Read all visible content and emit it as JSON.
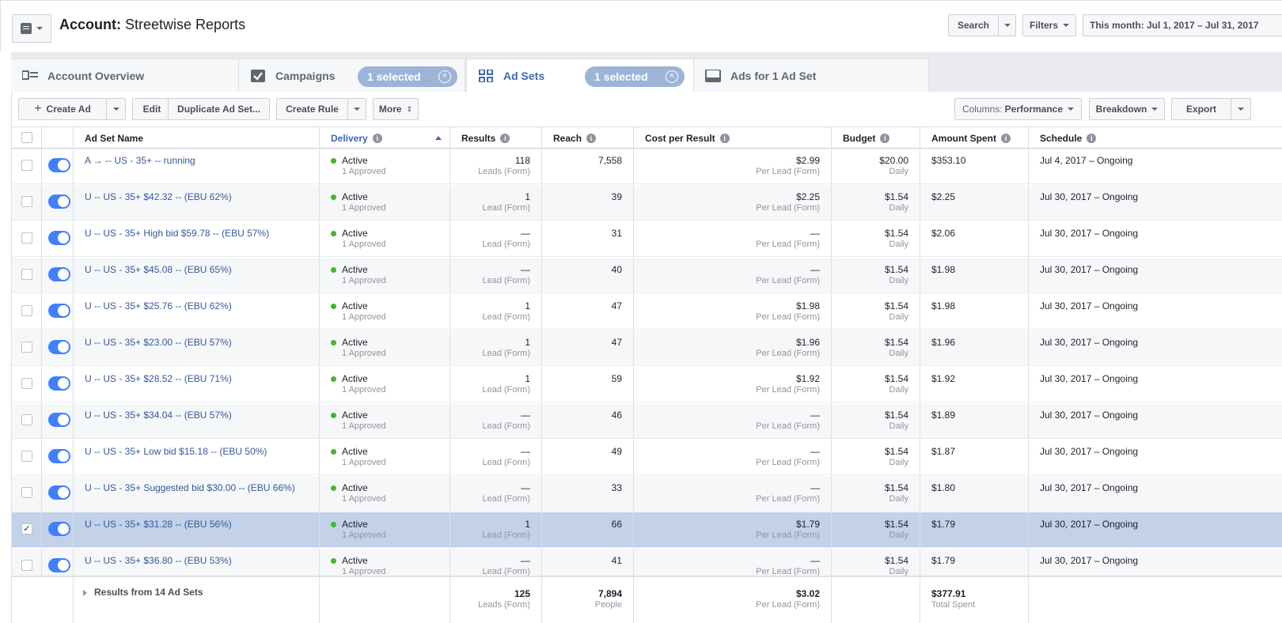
{
  "header": {
    "account_label": "Account:",
    "account_name": "Streetwise Reports",
    "search_label": "Search",
    "filters_label": "Filters",
    "date_range": "This month: Jul 1, 2017 – Jul 31, 2017"
  },
  "tabs": [
    {
      "label": "Account Overview"
    },
    {
      "label": "Campaigns",
      "selected_badge": "1 selected"
    },
    {
      "label": "Ad Sets",
      "selected_badge": "1 selected"
    },
    {
      "label": "Ads for 1 Ad Set"
    }
  ],
  "toolbar": {
    "create_ad": "Create Ad",
    "edit": "Edit",
    "duplicate": "Duplicate Ad Set...",
    "create_rule": "Create Rule",
    "more": "More",
    "columns_prefix": "Columns:",
    "columns_value": "Performance",
    "breakdown": "Breakdown",
    "export": "Export"
  },
  "columns": {
    "name": "Ad Set Name",
    "delivery": "Delivery",
    "results": "Results",
    "reach": "Reach",
    "cost": "Cost per Result",
    "budget": "Budget",
    "spent": "Amount Spent",
    "schedule": "Schedule"
  },
  "rows": [
    {
      "name": "A → -- US - 35+ -- running",
      "delivery": "Active",
      "delivery_sub": "1 Approved",
      "results": "118",
      "results_sub": "Leads (Form)",
      "reach": "7,558",
      "cost": "$2.99",
      "cost_sub": "Per Lead (Form)",
      "budget": "$20.00",
      "budget_sub": "Daily",
      "spent": "$353.10",
      "schedule": "Jul 4, 2017 – Ongoing",
      "checked": false
    },
    {
      "name": "U -- US - 35+ $42.32 -- (EBU 62%)",
      "delivery": "Active",
      "delivery_sub": "1 Approved",
      "results": "1",
      "results_sub": "Lead (Form)",
      "reach": "39",
      "cost": "$2.25",
      "cost_sub": "Per Lead (Form)",
      "budget": "$1.54",
      "budget_sub": "Daily",
      "spent": "$2.25",
      "schedule": "Jul 30, 2017 – Ongoing",
      "checked": false
    },
    {
      "name": "U -- US - 35+ High bid $59.78 -- (EBU 57%)",
      "delivery": "Active",
      "delivery_sub": "1 Approved",
      "results": "—",
      "results_sub": "Lead (Form)",
      "reach": "31",
      "cost": "—",
      "cost_sub": "Per Lead (Form)",
      "budget": "$1.54",
      "budget_sub": "Daily",
      "spent": "$2.06",
      "schedule": "Jul 30, 2017 – Ongoing",
      "checked": false
    },
    {
      "name": "U -- US - 35+ $45.08 -- (EBU 65%)",
      "delivery": "Active",
      "delivery_sub": "1 Approved",
      "results": "—",
      "results_sub": "Lead (Form)",
      "reach": "40",
      "cost": "—",
      "cost_sub": "Per Lead (Form)",
      "budget": "$1.54",
      "budget_sub": "Daily",
      "spent": "$1.98",
      "schedule": "Jul 30, 2017 – Ongoing",
      "checked": false
    },
    {
      "name": "U -- US - 35+ $25.76 -- (EBU 62%)",
      "delivery": "Active",
      "delivery_sub": "1 Approved",
      "results": "1",
      "results_sub": "Lead (Form)",
      "reach": "47",
      "cost": "$1.98",
      "cost_sub": "Per Lead (Form)",
      "budget": "$1.54",
      "budget_sub": "Daily",
      "spent": "$1.98",
      "schedule": "Jul 30, 2017 – Ongoing",
      "checked": false
    },
    {
      "name": "U -- US - 35+ $23.00 -- (EBU 57%)",
      "delivery": "Active",
      "delivery_sub": "1 Approved",
      "results": "1",
      "results_sub": "Lead (Form)",
      "reach": "47",
      "cost": "$1.96",
      "cost_sub": "Per Lead (Form)",
      "budget": "$1.54",
      "budget_sub": "Daily",
      "spent": "$1.96",
      "schedule": "Jul 30, 2017 – Ongoing",
      "checked": false
    },
    {
      "name": "U -- US - 35+ $28.52 -- (EBU 71%)",
      "delivery": "Active",
      "delivery_sub": "1 Approved",
      "results": "1",
      "results_sub": "Lead (Form)",
      "reach": "59",
      "cost": "$1.92",
      "cost_sub": "Per Lead (Form)",
      "budget": "$1.54",
      "budget_sub": "Daily",
      "spent": "$1.92",
      "schedule": "Jul 30, 2017 – Ongoing",
      "checked": false
    },
    {
      "name": "U -- US - 35+ $34.04 -- (EBU 57%)",
      "delivery": "Active",
      "delivery_sub": "1 Approved",
      "results": "—",
      "results_sub": "Lead (Form)",
      "reach": "46",
      "cost": "—",
      "cost_sub": "Per Lead (Form)",
      "budget": "$1.54",
      "budget_sub": "Daily",
      "spent": "$1.89",
      "schedule": "Jul 30, 2017 – Ongoing",
      "checked": false
    },
    {
      "name": "U -- US - 35+ Low bid $15.18 -- (EBU 50%)",
      "delivery": "Active",
      "delivery_sub": "1 Approved",
      "results": "—",
      "results_sub": "Lead (Form)",
      "reach": "49",
      "cost": "—",
      "cost_sub": "Per Lead (Form)",
      "budget": "$1.54",
      "budget_sub": "Daily",
      "spent": "$1.87",
      "schedule": "Jul 30, 2017 – Ongoing",
      "checked": false
    },
    {
      "name": "U -- US - 35+ Suggested bid $30.00 -- (EBU 66%)",
      "delivery": "Active",
      "delivery_sub": "1 Approved",
      "results": "—",
      "results_sub": "Lead (Form)",
      "reach": "33",
      "cost": "—",
      "cost_sub": "Per Lead (Form)",
      "budget": "$1.54",
      "budget_sub": "Daily",
      "spent": "$1.80",
      "schedule": "Jul 30, 2017 – Ongoing",
      "checked": false
    },
    {
      "name": "U -- US - 35+ $31.28 -- (EBU 56%)",
      "delivery": "Active",
      "delivery_sub": "1 Approved",
      "results": "1",
      "results_sub": "Lead (Form)",
      "reach": "66",
      "cost": "$1.79",
      "cost_sub": "Per Lead (Form)",
      "budget": "$1.54",
      "budget_sub": "Daily",
      "spent": "$1.79",
      "schedule": "Jul 30, 2017 – Ongoing",
      "checked": true
    },
    {
      "name": "U -- US - 35+ $36.80 -- (EBU 53%)",
      "delivery": "Active",
      "delivery_sub": "1 Approved",
      "results": "—",
      "results_sub": "Lead (Form)",
      "reach": "41",
      "cost": "—",
      "cost_sub": "Per Lead (Form)",
      "budget": "$1.54",
      "budget_sub": "Daily",
      "spent": "$1.79",
      "schedule": "Jul 30, 2017 – Ongoing",
      "checked": false
    }
  ],
  "totals": {
    "label": "Results from 14 Ad Sets",
    "results": "125",
    "results_sub": "Leads (Form)",
    "reach": "7,894",
    "reach_sub": "People",
    "cost": "$3.02",
    "cost_sub": "Per Lead (Form)",
    "spent": "$377.91",
    "spent_sub": "Total Spent"
  },
  "colors": {
    "accent": "#4267b2",
    "link": "#365899",
    "toggle_on": "#4080ff",
    "active_dot": "#42b72a",
    "selected_row": "#c3d1e9",
    "badge": "#9cb4d8"
  }
}
